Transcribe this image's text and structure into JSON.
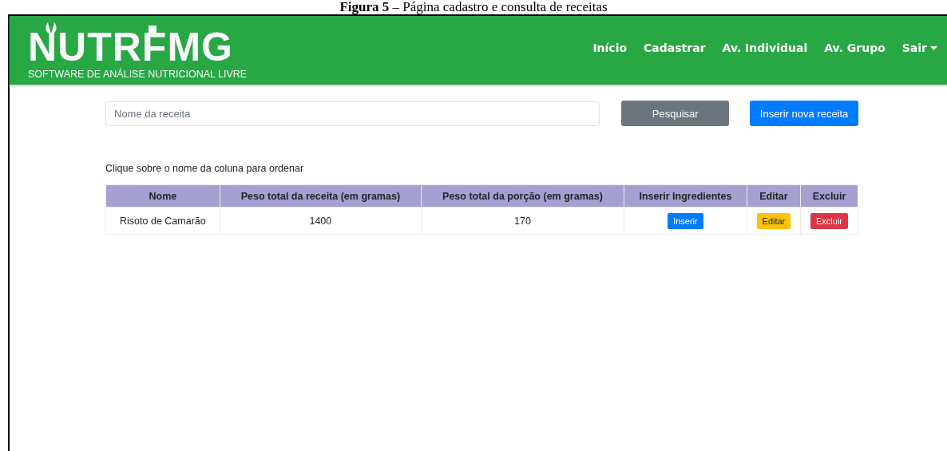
{
  "caption": {
    "label": "Figura 5",
    "text": " – Página cadastro e consulta de receitas"
  },
  "navbar": {
    "logo": "NUTRFMG",
    "tagline": "SOFTWARE DE ANÁLISE NUTRICIONAL LIVRE",
    "links": [
      {
        "label": "Início",
        "kind": "link"
      },
      {
        "label": "Cadastrar",
        "kind": "link"
      },
      {
        "label": "Av. Individual",
        "kind": "link"
      },
      {
        "label": "Av. Grupo",
        "kind": "link"
      },
      {
        "label": "Sair",
        "kind": "dropdown"
      }
    ]
  },
  "search": {
    "placeholder": "Nome da receita",
    "button": "Pesquisar",
    "new_button": "Inserir nova receita"
  },
  "hint": "Clique sobre o nome da coluna para ordenar",
  "table": {
    "columns": [
      "Nome",
      "Peso total da receita (em gramas)",
      "Peso total da porção (em gramas)",
      "Inserir Ingredientes",
      "Editar",
      "Excluir"
    ],
    "rows": [
      {
        "name": "Risoto de Camarão",
        "recipe_weight": "1400",
        "portion_weight": "170",
        "insert": "Inserir",
        "edit": "Editar",
        "delete": "Excluir"
      }
    ]
  }
}
